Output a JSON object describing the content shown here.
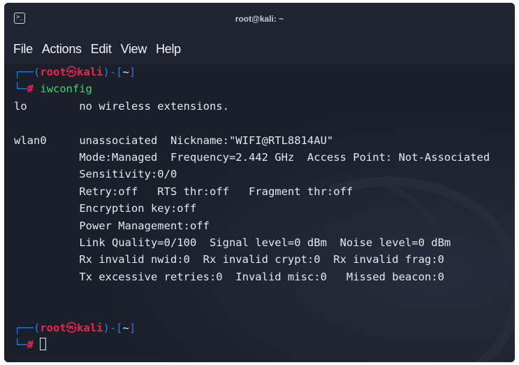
{
  "window": {
    "title": "root@kali: ~"
  },
  "menu": [
    "File",
    "Actions",
    "Edit",
    "View",
    "Help"
  ],
  "prompt": {
    "user": "root",
    "symbol": "㉿",
    "host": "kali",
    "path": "~",
    "hash": "#"
  },
  "command": "iwconfig",
  "output": [
    "lo        no wireless extensions.",
    "",
    "wlan0     unassociated  Nickname:\"WIFI@RTL8814AU\"",
    "          Mode:Managed  Frequency=2.442 GHz  Access Point: Not-Associated",
    "          Sensitivity:0/0",
    "          Retry:off   RTS thr:off   Fragment thr:off",
    "          Encryption key:off",
    "          Power Management:off",
    "          Link Quality=0/100  Signal level=0 dBm  Noise level=0 dBm",
    "          Rx invalid nwid:0  Rx invalid crypt:0  Rx invalid frag:0",
    "          Tx excessive retries:0  Invalid misc:0   Missed beacon:0",
    "",
    ""
  ]
}
